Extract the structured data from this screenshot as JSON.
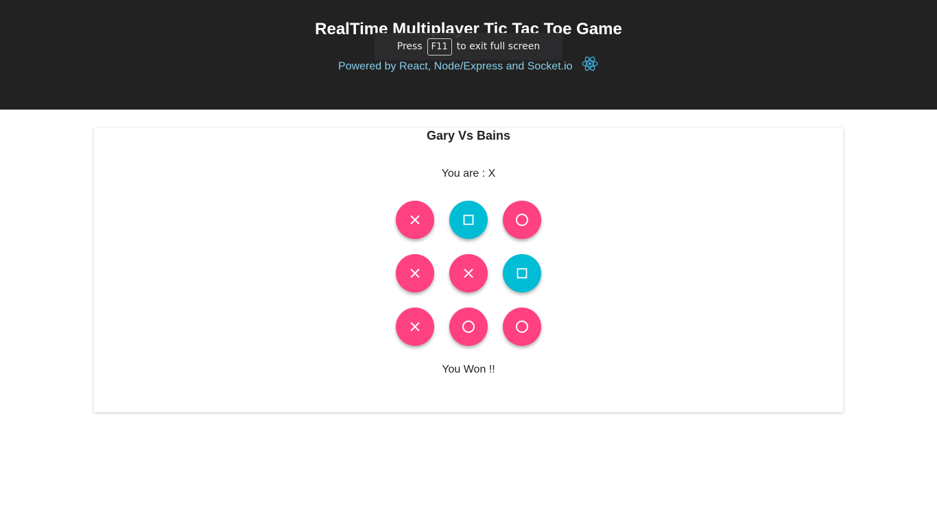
{
  "header": {
    "title": "RealTime Multiplayer Tic Tac Toe Game",
    "powered_by": "Powered by React, Node/Express and Socket.io",
    "icon": "react-atom-icon"
  },
  "fullscreen_notice": {
    "prefix": "Press",
    "key": "F11",
    "suffix": "to exit full screen"
  },
  "game": {
    "matchup": "Gary Vs Bains",
    "you_are": "You are : X",
    "status": "You Won !!",
    "colors": {
      "pink": "#ff4081",
      "cyan": "#00bcd4"
    },
    "board": [
      [
        "x",
        "square",
        "o"
      ],
      [
        "x",
        "x",
        "square"
      ],
      [
        "x",
        "o",
        "o"
      ]
    ]
  }
}
